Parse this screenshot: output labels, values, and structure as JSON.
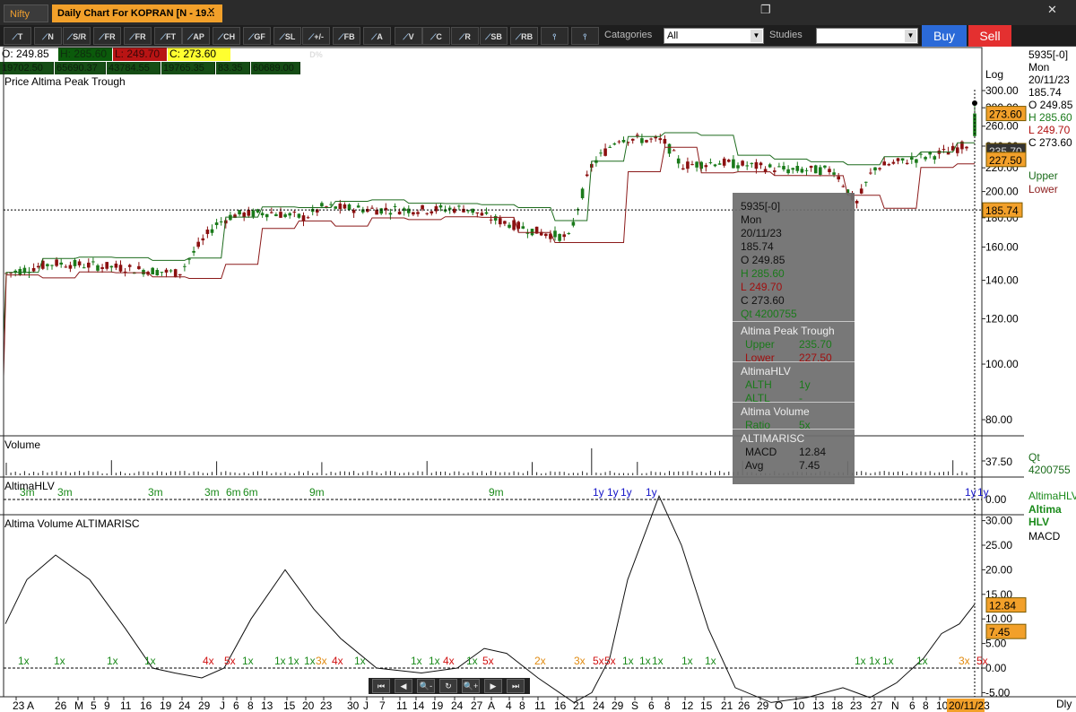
{
  "tabs": [
    {
      "label": "Nifty",
      "active": false
    },
    {
      "label": "Daily Chart For KOPRAN [N - 19...",
      "active": true
    }
  ],
  "window_controls": {
    "restore": "❐",
    "close": "✕"
  },
  "toolbar": {
    "tools": [
      {
        "icon": "pencil-icon",
        "label": "T"
      },
      {
        "icon": "line-icon",
        "label": "N"
      },
      {
        "icon": "sr-icon",
        "label": "S/R"
      },
      {
        "icon": "fr-icon",
        "label": "FR"
      },
      {
        "icon": "fr2-icon",
        "label": "FR"
      },
      {
        "icon": "ft-icon",
        "label": "FT"
      },
      {
        "icon": "ap-icon",
        "label": "AP"
      },
      {
        "icon": "ch-icon",
        "label": "CH"
      },
      {
        "icon": "gf-icon",
        "label": "GF"
      },
      {
        "icon": "sl-icon",
        "label": "SL"
      },
      {
        "icon": "pct-icon",
        "label": "+/-D%"
      },
      {
        "icon": "fb-icon",
        "label": "FB"
      },
      {
        "icon": "text-icon",
        "label": "A"
      },
      {
        "icon": "v-icon",
        "label": "V"
      },
      {
        "icon": "circle-icon",
        "label": "C"
      },
      {
        "icon": "rect-icon",
        "label": "R"
      },
      {
        "icon": "sb-icon",
        "label": "SB"
      },
      {
        "icon": "rb-icon",
        "label": "RB"
      },
      {
        "icon": "hline-icon",
        "label": ""
      },
      {
        "icon": "hline2-icon",
        "label": ""
      }
    ],
    "categories_label": "Catagories",
    "categories_value": "All",
    "studies_label": "Studies",
    "studies_value": "",
    "buy_label": "Buy",
    "sell_label": "Sell"
  },
  "ohlc": {
    "open": "O: 249.85",
    "high": "H: 285.60",
    "low": "L: 249.70",
    "close": "C: 273.60"
  },
  "stats": [
    "19702.50",
    "65690.37",
    "43784.55",
    "19765.35",
    "83.35",
    "60689.00"
  ],
  "colors": {
    "up": "#1a7a1a",
    "down": "#8b1010",
    "upper_line": "#1d6b1d",
    "lower_line": "#8b1a1a",
    "accent": "#f2a02a"
  },
  "price_panel": {
    "title": "Price    Altima Peak Trough",
    "scale_label": "Log",
    "ticks": [
      "300.00",
      "280.00",
      "260.00",
      "240.00",
      "220.00",
      "200.00",
      "180.00",
      "160.00",
      "140.00",
      "120.00",
      "100.00",
      "80.00"
    ],
    "last_price": "273.60",
    "crosshair_price": "185.74",
    "upper_badge": "235.70",
    "lower_badge": "227.50",
    "legend": [
      {
        "name": "Upper"
      },
      {
        "name": "Lower"
      }
    ]
  },
  "volume_panel": {
    "title": "Volume",
    "tick": "37.50",
    "right_label": "Qt 4200755"
  },
  "hlv_panel": {
    "title": "AltimaHLV",
    "right_labels": [
      "AltimaHLV",
      "Altima HLV"
    ],
    "markers": [
      {
        "label": "3m",
        "color": "#1a8a1a",
        "x": 22
      },
      {
        "label": "3m",
        "color": "#1a8a1a",
        "x": 64
      },
      {
        "label": "3m",
        "color": "#1a8a1a",
        "x": 165
      },
      {
        "label": "3m",
        "color": "#1a8a1a",
        "x": 228
      },
      {
        "label": "6m",
        "color": "#1a8a1a",
        "x": 252
      },
      {
        "label": "6m",
        "color": "#1a8a1a",
        "x": 271
      },
      {
        "label": "9m",
        "color": "#1a8a1a",
        "x": 345
      },
      {
        "label": "9m",
        "color": "#1a8a1a",
        "x": 545
      },
      {
        "label": "1y",
        "color": "#1515c8",
        "x": 661
      },
      {
        "label": "1y",
        "color": "#1515c8",
        "x": 677
      },
      {
        "label": "1y",
        "color": "#1515c8",
        "x": 692
      },
      {
        "label": "1y",
        "color": "#1515c8",
        "x": 720
      },
      {
        "label": "1y",
        "color": "#1515c8",
        "x": 1076
      },
      {
        "label": "1y",
        "color": "#1515c8",
        "x": 1090
      }
    ]
  },
  "osc_panel": {
    "title": "Altima Volume    ALTIMARISC",
    "ticks": [
      "30.00",
      "25.00",
      "20.00",
      "15.00",
      "10.00",
      "5.00",
      "0.00",
      "-5.00"
    ],
    "hlv_tick": "0.00",
    "macd_badge": "12.84",
    "avg_badge": "7.45",
    "right_label": "MACD",
    "volume_markers": [
      {
        "label": "1x",
        "color": "#1a8a1a",
        "x": 20
      },
      {
        "label": "1x",
        "color": "#1a8a1a",
        "x": 60
      },
      {
        "label": "1x",
        "color": "#1a8a1a",
        "x": 119
      },
      {
        "label": "1x",
        "color": "#1a8a1a",
        "x": 161
      },
      {
        "label": "4x",
        "color": "#d01010",
        "x": 226
      },
      {
        "label": "5x",
        "color": "#d01010",
        "x": 250
      },
      {
        "label": "1x",
        "color": "#1a8a1a",
        "x": 270
      },
      {
        "label": "1x",
        "color": "#1a8a1a",
        "x": 306
      },
      {
        "label": "1x",
        "color": "#1a8a1a",
        "x": 321
      },
      {
        "label": "1x",
        "color": "#1a8a1a",
        "x": 339
      },
      {
        "label": "3x",
        "color": "#e08a10",
        "x": 352
      },
      {
        "label": "4x",
        "color": "#d01010",
        "x": 370
      },
      {
        "label": "1x",
        "color": "#1a8a1a",
        "x": 395
      },
      {
        "label": "1x",
        "color": "#1a8a1a",
        "x": 458
      },
      {
        "label": "1x",
        "color": "#1a8a1a",
        "x": 478
      },
      {
        "label": "4x",
        "color": "#d01010",
        "x": 494
      },
      {
        "label": "1x",
        "color": "#1a8a1a",
        "x": 520
      },
      {
        "label": "5x",
        "color": "#d01010",
        "x": 538
      },
      {
        "label": "2x",
        "color": "#e08a10",
        "x": 596
      },
      {
        "label": "3x",
        "color": "#e08a10",
        "x": 640
      },
      {
        "label": "5x",
        "color": "#d01010",
        "x": 661
      },
      {
        "label": "5x",
        "color": "#d01010",
        "x": 674
      },
      {
        "label": "1x",
        "color": "#1a8a1a",
        "x": 694
      },
      {
        "label": "1x",
        "color": "#1a8a1a",
        "x": 713
      },
      {
        "label": "1x",
        "color": "#1a8a1a",
        "x": 727
      },
      {
        "label": "1x",
        "color": "#1a8a1a",
        "x": 760
      },
      {
        "label": "1x",
        "color": "#1a8a1a",
        "x": 786
      },
      {
        "label": "1x",
        "color": "#1a8a1a",
        "x": 953
      },
      {
        "label": "1x",
        "color": "#1a8a1a",
        "x": 969
      },
      {
        "label": "1x",
        "color": "#1a8a1a",
        "x": 984
      },
      {
        "label": "1x",
        "color": "#1a8a1a",
        "x": 1022
      },
      {
        "label": "3x",
        "color": "#e08a10",
        "x": 1069
      },
      {
        "label": "5x",
        "color": "#d01010",
        "x": 1089
      }
    ]
  },
  "xaxis": {
    "labels": [
      {
        "t": "23 A",
        "x": 18
      },
      {
        "t": "26",
        "x": 65
      },
      {
        "t": "M",
        "x": 87
      },
      {
        "t": "5",
        "x": 105
      },
      {
        "t": "9",
        "x": 120
      },
      {
        "t": "11",
        "x": 138
      },
      {
        "t": "16",
        "x": 160
      },
      {
        "t": "19",
        "x": 182
      },
      {
        "t": "24",
        "x": 203
      },
      {
        "t": "29",
        "x": 225
      },
      {
        "t": "J",
        "x": 249
      },
      {
        "t": "6",
        "x": 264
      },
      {
        "t": "8",
        "x": 280
      },
      {
        "t": "13",
        "x": 295
      },
      {
        "t": "15",
        "x": 320
      },
      {
        "t": "20",
        "x": 341
      },
      {
        "t": "23",
        "x": 361
      },
      {
        "t": "30",
        "x": 391
      },
      {
        "t": "J",
        "x": 409
      },
      {
        "t": "7",
        "x": 427
      },
      {
        "t": "11",
        "x": 446
      },
      {
        "t": "14",
        "x": 464
      },
      {
        "t": "19",
        "x": 485
      },
      {
        "t": "24",
        "x": 507
      },
      {
        "t": "27",
        "x": 529
      },
      {
        "t": "A",
        "x": 548
      },
      {
        "t": "4",
        "x": 568
      },
      {
        "t": "8",
        "x": 583
      },
      {
        "t": "11",
        "x": 600
      },
      {
        "t": "16",
        "x": 622
      },
      {
        "t": "21",
        "x": 643
      },
      {
        "t": "24",
        "x": 665
      },
      {
        "t": "29",
        "x": 686
      },
      {
        "t": "S",
        "x": 708
      },
      {
        "t": "6",
        "x": 727
      },
      {
        "t": "8",
        "x": 745
      },
      {
        "t": "12",
        "x": 764
      },
      {
        "t": "15",
        "x": 785
      },
      {
        "t": "21",
        "x": 808
      },
      {
        "t": "26",
        "x": 827
      },
      {
        "t": "29",
        "x": 848
      },
      {
        "t": "O",
        "x": 868
      },
      {
        "t": "10",
        "x": 888
      },
      {
        "t": "13",
        "x": 910
      },
      {
        "t": "18",
        "x": 931
      },
      {
        "t": "23",
        "x": 952
      },
      {
        "t": "27",
        "x": 975
      },
      {
        "t": "N",
        "x": 998
      },
      {
        "t": "6",
        "x": 1018
      },
      {
        "t": "8",
        "x": 1033
      },
      {
        "t": "10",
        "x": 1048
      }
    ],
    "current_date": "20/11/23",
    "period_label": "Dly"
  },
  "right_info": {
    "lines": [
      {
        "t": "5935[-0]",
        "c": "#000"
      },
      {
        "t": "Mon",
        "c": "#000"
      },
      {
        "t": "20/11/23",
        "c": "#000"
      },
      {
        "t": "185.74",
        "c": "#000"
      },
      {
        "t": "O 249.85",
        "c": "#000"
      },
      {
        "t": "H 285.60",
        "c": "#1a7a1a"
      },
      {
        "t": "L 249.70",
        "c": "#b01010"
      },
      {
        "t": "C 273.60",
        "c": "#000"
      }
    ]
  },
  "tooltip": {
    "lines": [
      {
        "t": "5935[-0]",
        "c": "#111"
      },
      {
        "t": "Mon",
        "c": "#111"
      },
      {
        "t": "20/11/23",
        "c": "#111"
      },
      {
        "t": "185.74",
        "c": "#111"
      },
      {
        "t": "O  249.85",
        "c": "#111"
      },
      {
        "t": "H  285.60",
        "c": "#1a7a1a"
      },
      {
        "t": "L  249.70",
        "c": "#a01010"
      },
      {
        "t": "C  273.60",
        "c": "#111"
      },
      {
        "t": "Qt  4200755",
        "c": "#1a7a1a"
      }
    ],
    "sections": [
      {
        "head": "Altima Peak Trough",
        "rows": [
          {
            "k": "Upper",
            "v": "235.70",
            "c": "#1a7a1a"
          },
          {
            "k": "Lower",
            "v": "227.50",
            "c": "#a01010"
          }
        ]
      },
      {
        "head": "AltimaHLV",
        "rows": [
          {
            "k": "ALTH",
            "v": "1y",
            "c": "#1a7a1a"
          },
          {
            "k": "ALTL",
            "v": "-",
            "c": "#1a7a1a"
          }
        ]
      },
      {
        "head": "Altima Volume",
        "rows": [
          {
            "k": "Ratio",
            "v": "5x",
            "c": "#1a7a1a"
          }
        ]
      },
      {
        "head": "ALTIMARISC",
        "rows": [
          {
            "k": "MACD",
            "v": "12.84",
            "c": "#111"
          },
          {
            "k": "Avg",
            "v": "7.45",
            "c": "#111"
          }
        ]
      }
    ]
  },
  "navigation": {
    "buttons": [
      "⏮",
      "◀",
      "🔍-",
      "↻",
      "🔍+",
      "▶",
      "⏭"
    ]
  },
  "chart_data": {
    "type": "candlestick",
    "scale": "log",
    "ylim": [
      80,
      300
    ],
    "points_anchor": [
      {
        "x": 0,
        "close": 143
      },
      {
        "x": 60,
        "close": 150
      },
      {
        "x": 120,
        "close": 148
      },
      {
        "x": 200,
        "close": 144
      },
      {
        "x": 240,
        "close": 175
      },
      {
        "x": 260,
        "close": 182
      },
      {
        "x": 300,
        "close": 184
      },
      {
        "x": 340,
        "close": 180
      },
      {
        "x": 360,
        "close": 188
      },
      {
        "x": 420,
        "close": 186
      },
      {
        "x": 480,
        "close": 186
      },
      {
        "x": 520,
        "close": 187
      },
      {
        "x": 545,
        "close": 180
      },
      {
        "x": 600,
        "close": 170
      },
      {
        "x": 635,
        "close": 166
      },
      {
        "x": 660,
        "close": 222
      },
      {
        "x": 690,
        "close": 248
      },
      {
        "x": 740,
        "close": 245
      },
      {
        "x": 760,
        "close": 222
      },
      {
        "x": 800,
        "close": 225
      },
      {
        "x": 880,
        "close": 218
      },
      {
        "x": 930,
        "close": 218
      },
      {
        "x": 955,
        "close": 190
      },
      {
        "x": 975,
        "close": 220
      },
      {
        "x": 1020,
        "close": 228
      },
      {
        "x": 1060,
        "close": 235
      },
      {
        "x": 1083,
        "close": 244
      },
      {
        "x": 1087,
        "close": 273.6
      }
    ]
  }
}
